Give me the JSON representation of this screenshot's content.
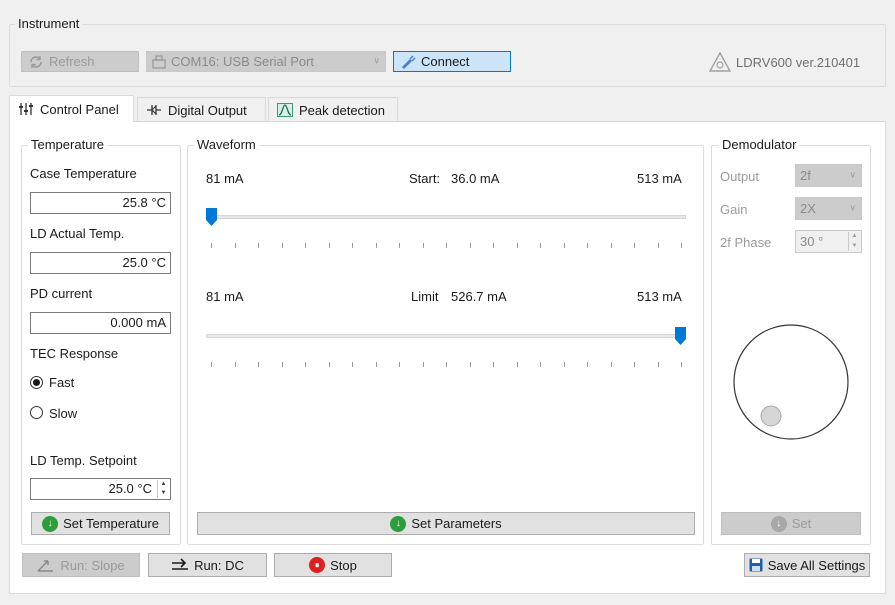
{
  "instrument": {
    "title": "Instrument",
    "refresh_label": "Refresh",
    "port_value": "COM16: USB Serial Port",
    "connect_label": "Connect",
    "version": "LDRV600 ver.210401"
  },
  "tabs": [
    {
      "label": "Control Panel",
      "icon": "sliders-icon",
      "active": true
    },
    {
      "label": "Digital Output",
      "icon": "digital-icon",
      "active": false
    },
    {
      "label": "Peak detection",
      "icon": "peak-icon",
      "active": false
    }
  ],
  "temperature": {
    "title": "Temperature",
    "case_label": "Case Temperature",
    "case_value": "25.8 °C",
    "ld_label": "LD Actual Temp.",
    "ld_value": "25.0 °C",
    "pd_label": "PD current",
    "pd_value": "0.000 mA",
    "tec_label": "TEC Response",
    "fast_label": "Fast",
    "slow_label": "Slow",
    "tec_selected": "Fast",
    "setpoint_label": "LD Temp. Setpoint",
    "setpoint_value": "25.0 °C",
    "set_button": "Set Temperature"
  },
  "waveform": {
    "title": "Waveform",
    "start": {
      "min_label": "81 mA",
      "caption": "Start:",
      "value_label": "36.0 mA",
      "max_label": "513 mA",
      "min": 81,
      "max": 513,
      "value": 36.0
    },
    "limit": {
      "min_label": "81 mA",
      "caption": "Limit",
      "value_label": "526.7 mA",
      "max_label": "513 mA",
      "min": 81,
      "max": 513,
      "value": 526.7
    },
    "set_button": "Set Parameters"
  },
  "demodulator": {
    "title": "Demodulator",
    "output_label": "Output",
    "output_value": "2f",
    "gain_label": "Gain",
    "gain_value": "2X",
    "phase_label": "2f Phase",
    "phase_value": "30 °",
    "set_button": "Set"
  },
  "footer": {
    "run_slope": "Run: Slope",
    "run_dc": "Run: DC",
    "stop": "Stop",
    "save_all": "Save All Settings"
  },
  "colors": {
    "accent": "#0078d7",
    "green": "#2e9e3c",
    "red": "#e02020"
  }
}
